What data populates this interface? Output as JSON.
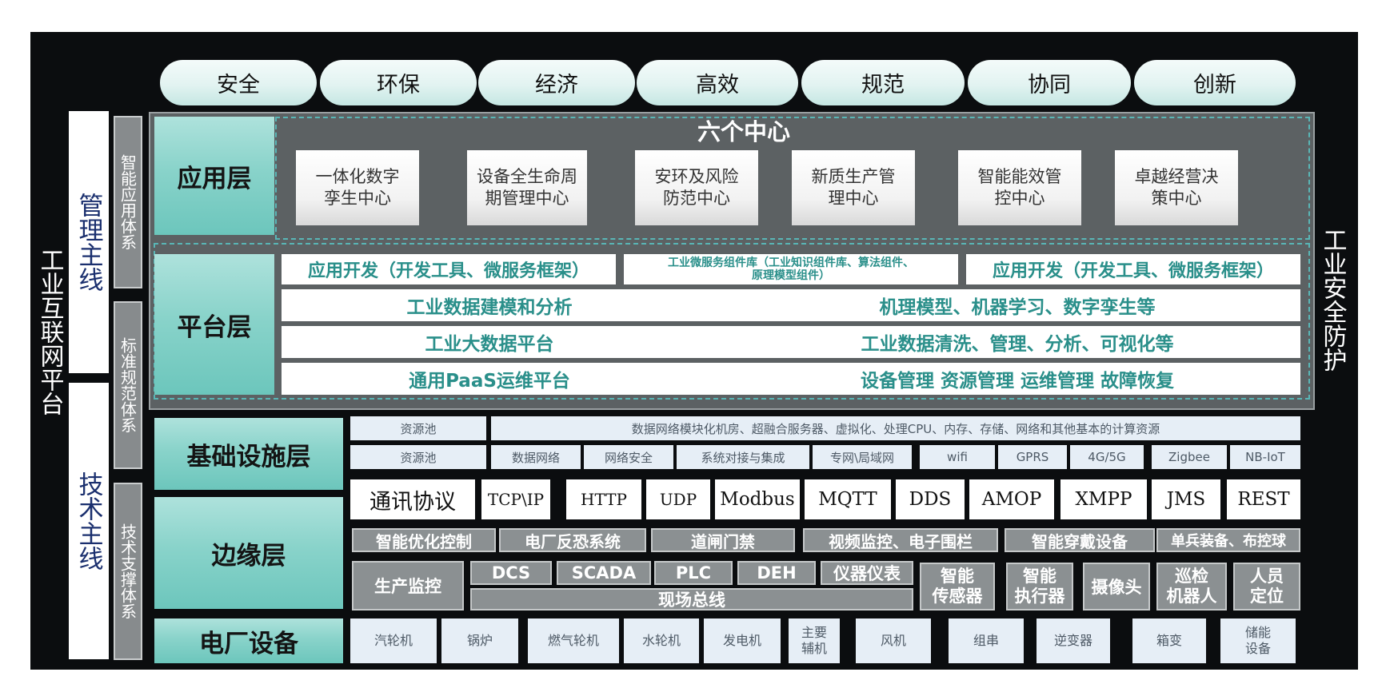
{
  "top_values": [
    "安全",
    "环保",
    "经济",
    "高效",
    "规范",
    "协同",
    "创新"
  ],
  "left_title": "工业互联网平台",
  "right_title": "工业安全防护",
  "mgmt_line": "管理主线",
  "tech_line": "技术主线",
  "side_systems": [
    "智能应用体系",
    "标准规范体系",
    "技术支撑体系"
  ],
  "app_layer": {
    "label": "应用层",
    "title": "六个中心",
    "centers": [
      [
        "一体化数字",
        "孪生中心"
      ],
      [
        "设备全生命周",
        "期管理中心"
      ],
      [
        "安环及风险",
        "防范中心"
      ],
      [
        "新质生产管",
        "理中心"
      ],
      [
        "智能能效管",
        "控中心"
      ],
      [
        "卓越经营决",
        "策中心"
      ]
    ]
  },
  "platform_layer": {
    "label": "平台层",
    "top_left": "应用开发（开发工具、微服务框架）",
    "top_mid": [
      "工业微服务组件库（工业知识组件库、算法组件、",
      "原理模型组件）"
    ],
    "top_right": "应用开发（开发工具、微服务框架）",
    "rows": [
      {
        "left": "工业数据建模和分析",
        "right": "机理模型、机器学习、数字孪生等"
      },
      {
        "left": "工业大数据平台",
        "right": "工业数据清洗、管理、分析、可视化等"
      },
      {
        "left": "通用PaaS运维平台",
        "right": "设备管理 资源管理 运维管理 故障恢复"
      }
    ]
  },
  "infra_layer": {
    "label": "基础设施层",
    "row1": [
      "资源池",
      "数据网络模块化机房、超融合服务器、虚拟化、处理CPU、内存、存储、网络和其他基本的计算资源"
    ],
    "row2": [
      "资源池",
      "数据网络",
      "网络安全",
      "系统对接与集成",
      "专网\\局域网",
      "wifi",
      "GPRS",
      "4G/5G",
      "Zigbee",
      "NB-IoT"
    ]
  },
  "edge_layer": {
    "label": "边缘层",
    "protocol_label": "通讯协议",
    "protocols": [
      "TCP\\IP",
      "HTTP",
      "UDP",
      "Modbus",
      "MQTT",
      "DDS",
      "AMOP",
      "XMPP",
      "JMS",
      "REST"
    ],
    "systems": [
      "智能优化控制",
      "电厂反恐系统",
      "道闸门禁",
      "视频监控、电子围栏",
      "智能穿戴设备",
      "单兵装备、布控球"
    ],
    "production": "生产监控",
    "buses": [
      "DCS",
      "SCADA",
      "PLC",
      "DEH",
      "仪器仪表"
    ],
    "field_bus": "现场总线",
    "devices": [
      [
        "智能",
        "传感器"
      ],
      [
        "智能",
        "执行器"
      ],
      [
        "摄像头"
      ],
      [
        "巡检",
        "机器人"
      ],
      [
        "人员",
        "定位"
      ]
    ]
  },
  "equipment_layer": {
    "label": "电厂设备",
    "items": [
      [
        "汽轮机"
      ],
      [
        "锅炉"
      ],
      [
        "燃气轮机"
      ],
      [
        "水轮机"
      ],
      [
        "发电机"
      ],
      [
        "主要",
        "辅机"
      ],
      [
        "风机"
      ],
      [
        "组串"
      ],
      [
        "逆变器"
      ],
      [
        "箱变"
      ],
      [
        "储能",
        "设备"
      ]
    ]
  },
  "colors": {
    "frame": "#0b0d0f",
    "panel": "#5c6163",
    "teal": "#6cc6bc",
    "text_teal": "#2a8f8a",
    "navy": "#1a2f6e"
  }
}
